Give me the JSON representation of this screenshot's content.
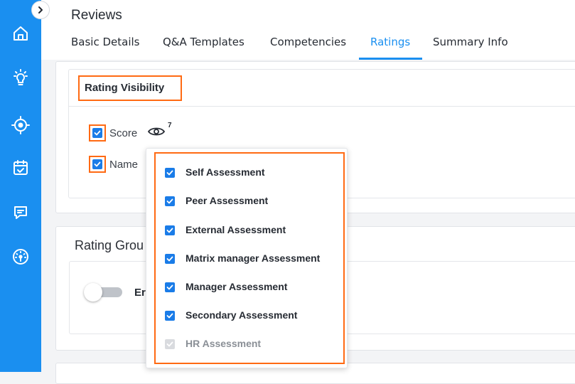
{
  "header": {
    "title": "Reviews"
  },
  "tabs": [
    {
      "label": "Basic Details",
      "active": false
    },
    {
      "label": "Q&A Templates",
      "active": false
    },
    {
      "label": "Competencies",
      "active": false
    },
    {
      "label": "Ratings",
      "active": true
    },
    {
      "label": "Summary Info",
      "active": false
    }
  ],
  "sidebar": {
    "icons": [
      "home-icon",
      "bulb-icon",
      "target-icon",
      "calendar-check-icon",
      "chat-icon",
      "gauge-icon"
    ]
  },
  "rating_visibility": {
    "title": "Rating Visibility",
    "options": [
      {
        "label": "Score",
        "checked": true,
        "badge": "7"
      },
      {
        "label": "Name",
        "checked": true
      }
    ]
  },
  "rating_group": {
    "title": "Rating Grou",
    "toggle_label": "Er",
    "enabled": false
  },
  "dropdown": {
    "items": [
      {
        "label": "Self Assessment",
        "checked": true,
        "disabled": false
      },
      {
        "label": "Peer Assessment",
        "checked": true,
        "disabled": false
      },
      {
        "label": "External Assessment",
        "checked": true,
        "disabled": false
      },
      {
        "label": "Matrix manager Assessment",
        "checked": true,
        "disabled": false
      },
      {
        "label": "Manager Assessment",
        "checked": true,
        "disabled": false
      },
      {
        "label": "Secondary Assessment",
        "checked": true,
        "disabled": false
      },
      {
        "label": "HR Assessment",
        "checked": true,
        "disabled": true
      }
    ]
  },
  "colors": {
    "accent": "#1a8ff0",
    "highlight": "#ff6a13",
    "checkbox": "#1a7ce8"
  }
}
